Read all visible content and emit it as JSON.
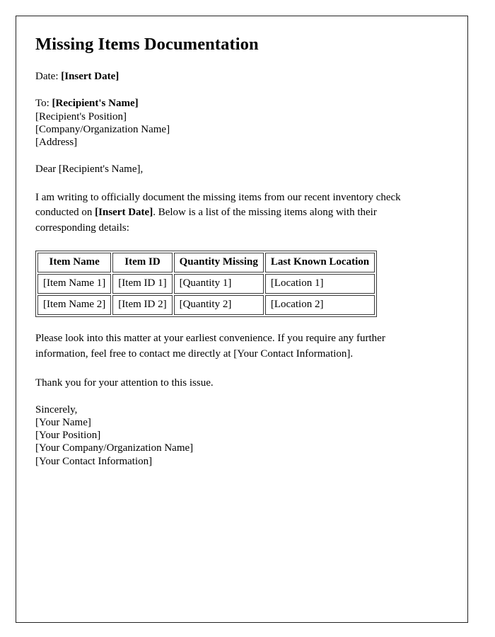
{
  "document": {
    "title": "Missing Items Documentation",
    "date_label": "Date:",
    "date_value": "[Insert Date]",
    "recipient": {
      "to_label": "To:",
      "name": "[Recipient's Name]",
      "position": "[Recipient's Position]",
      "organization": "[Company/Organization Name]",
      "address": "[Address]"
    },
    "salutation": "Dear [Recipient's Name],",
    "body": {
      "intro_part1": "I am writing to officially document the missing items from our recent inventory check conducted on ",
      "intro_date": "[Insert Date]",
      "intro_part2": ". Below is a list of the missing items along with their corresponding details:",
      "follow_up": "Please look into this matter at your earliest convenience. If you require any further information, feel free to contact me directly at [Your Contact Information].",
      "thanks": "Thank you for your attention to this issue."
    },
    "table": {
      "headers": [
        "Item Name",
        "Item ID",
        "Quantity Missing",
        "Last Known Location"
      ],
      "rows": [
        [
          "[Item Name 1]",
          "[Item ID 1]",
          "[Quantity 1]",
          "[Location 1]"
        ],
        [
          "[Item Name 2]",
          "[Item ID 2]",
          "[Quantity 2]",
          "[Location 2]"
        ]
      ]
    },
    "signature": {
      "closing": "Sincerely,",
      "name": "[Your Name]",
      "position": "[Your Position]",
      "organization": "[Your Company/Organization Name]",
      "contact": "[Your Contact Information]"
    }
  }
}
